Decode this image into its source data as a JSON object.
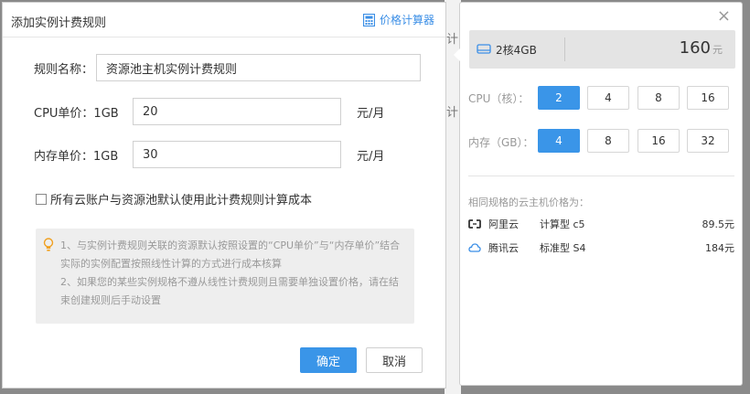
{
  "dialog": {
    "title": "添加实例计费规则",
    "calc_link": "价格计算器",
    "fields": {
      "rule_name": {
        "label": "规则名称：",
        "value": "资源池主机实例计费规则"
      },
      "cpu_price": {
        "label": "CPU单价：1GB",
        "value": "20",
        "unit": "元/月"
      },
      "mem_price": {
        "label": "内存单价：1GB",
        "value": "30",
        "unit": "元/月"
      }
    },
    "checkbox_label": "所有云账户与资源池默认使用此计费规则计算成本",
    "tips": [
      "1、与实例计费规则关联的资源默认按照设置的“CPU单价”与“内存单价”结合实际的实例配置按照线性计算的方式进行成本核算",
      "2、如果您的某些实例规格不遵从线性计费规则且需要单独设置价格，请在结束创建规则后手动设置"
    ],
    "confirm_label": "确定",
    "cancel_label": "取消"
  },
  "background_fragments": [
    "计",
    "计"
  ],
  "calculator": {
    "close_label": "×",
    "spec": "2核4GB",
    "price": "160",
    "price_unit": "元",
    "cpu_label": "CPU（核）：",
    "cpu_options": [
      "2",
      "4",
      "8",
      "16"
    ],
    "cpu_selected": "2",
    "mem_label": "内存（GB）：",
    "mem_options": [
      "4",
      "8",
      "16",
      "32"
    ],
    "mem_selected": "4",
    "same_spec_title": "相同规格的云主机价格为：",
    "vendors": [
      {
        "name": "阿里云",
        "type": "计算型 c5",
        "price": "89.5元",
        "icon": "aliyun-icon"
      },
      {
        "name": "腾讯云",
        "type": "标准型 S4",
        "price": "184元",
        "icon": "tencent-cloud-icon"
      }
    ]
  },
  "colors": {
    "accent": "#3a95e8",
    "link": "#3a8ee6",
    "tip_bg": "#eeeeee"
  }
}
